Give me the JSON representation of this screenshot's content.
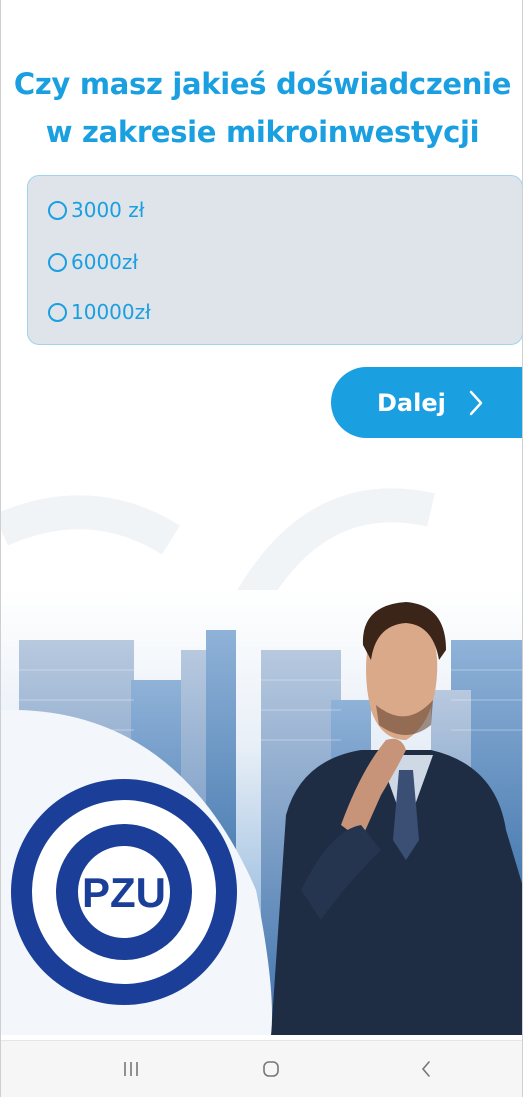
{
  "question": {
    "line1": "Czy masz jakieś doświadczenie",
    "line2": "w zakresie mikroinwestycji"
  },
  "options": [
    {
      "label": "3000 zł",
      "selected": false
    },
    {
      "label": "6000zł",
      "selected": false
    },
    {
      "label": "10000zł",
      "selected": false
    }
  ],
  "next_button": {
    "label": "Dalej",
    "icon": "chevron-right-icon"
  },
  "logo": {
    "text": "PZU"
  },
  "navbar": {
    "recent_icon": "recent-apps-icon",
    "home_icon": "home-icon",
    "back_icon": "back-icon"
  },
  "colors": {
    "accent": "#1a9fe0",
    "option_bg": "#dfe4ea",
    "logo_blue": "#1b3f99"
  }
}
